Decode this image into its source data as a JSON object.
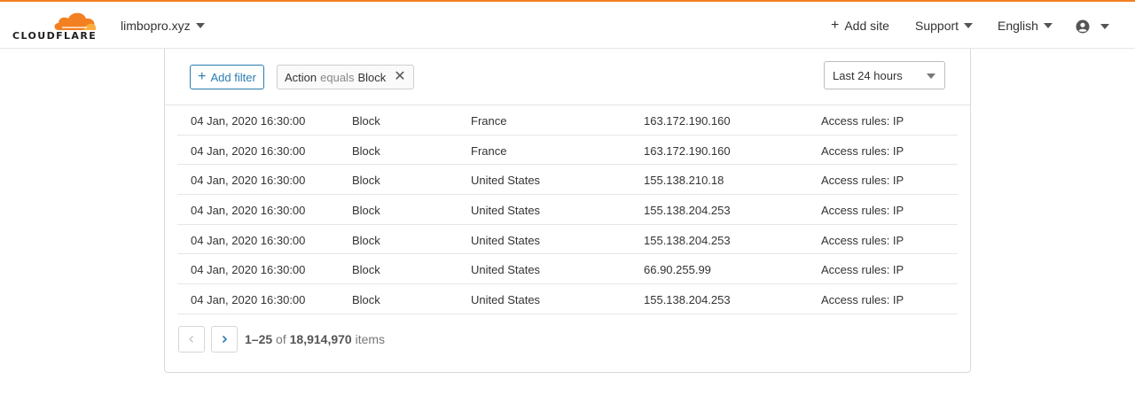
{
  "header": {
    "logo_text": "CLOUDFLARE",
    "site": "limbopro.xyz",
    "add_site": "Add site",
    "support": "Support",
    "language": "English",
    "accent_color": "#f38020"
  },
  "filters": {
    "add_filter_label": "Add filter",
    "chip": {
      "field": "Action",
      "operator": "equals",
      "value": "Block"
    },
    "time_range": "Last 24 hours"
  },
  "rows": [
    {
      "time": "04 Jan, 2020 16:30:00",
      "action": "Block",
      "country": "France",
      "ip": "163.172.190.160",
      "service": "Access rules: IP"
    },
    {
      "time": "04 Jan, 2020 16:30:00",
      "action": "Block",
      "country": "France",
      "ip": "163.172.190.160",
      "service": "Access rules: IP"
    },
    {
      "time": "04 Jan, 2020 16:30:00",
      "action": "Block",
      "country": "United States",
      "ip": "155.138.210.18",
      "service": "Access rules: IP"
    },
    {
      "time": "04 Jan, 2020 16:30:00",
      "action": "Block",
      "country": "United States",
      "ip": "155.138.204.253",
      "service": "Access rules: IP"
    },
    {
      "time": "04 Jan, 2020 16:30:00",
      "action": "Block",
      "country": "United States",
      "ip": "155.138.204.253",
      "service": "Access rules: IP"
    },
    {
      "time": "04 Jan, 2020 16:30:00",
      "action": "Block",
      "country": "United States",
      "ip": "66.90.255.99",
      "service": "Access rules: IP"
    },
    {
      "time": "04 Jan, 2020 16:30:00",
      "action": "Block",
      "country": "United States",
      "ip": "155.138.204.253",
      "service": "Access rules: IP"
    }
  ],
  "pagination": {
    "range": "1–25",
    "of": "of",
    "total": "18,914,970",
    "unit": "items"
  }
}
